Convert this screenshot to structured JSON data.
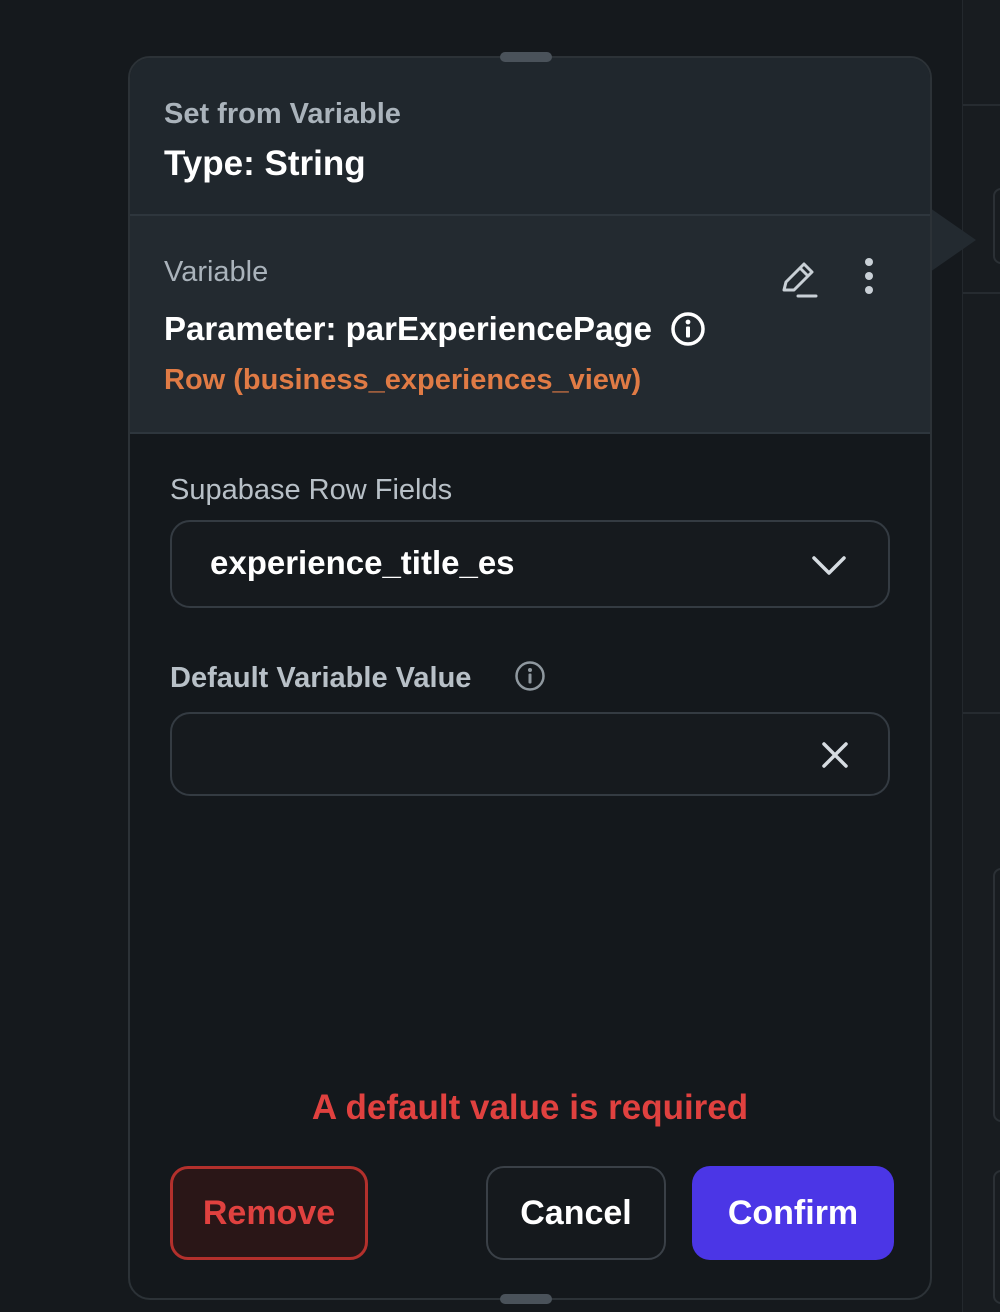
{
  "header": {
    "overline": "Set from Variable",
    "type_line": "Type: String"
  },
  "variable": {
    "overline": "Variable",
    "name": "Parameter: parExperiencePage",
    "row_type": "Row (business_experiences_view)",
    "row_type_color": "#e07b45"
  },
  "fields": {
    "row_fields": {
      "label": "Supabase Row Fields",
      "selected": "experience_title_es"
    },
    "default_value": {
      "label": "Default Variable Value",
      "value": ""
    }
  },
  "error": {
    "message": "A default value is required",
    "color": "#e0413f"
  },
  "actions": {
    "remove": "Remove",
    "cancel": "Cancel",
    "confirm": "Confirm",
    "confirm_color": "#4b36e6"
  },
  "icons": [
    "edit-icon",
    "more-vertical-icon",
    "info-icon",
    "chevron-down-icon",
    "close-icon",
    "drag-handle-icon"
  ]
}
